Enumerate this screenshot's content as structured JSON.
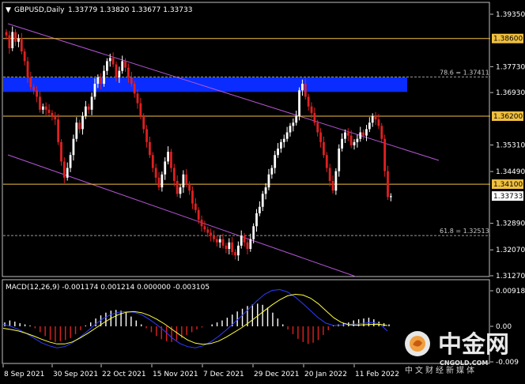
{
  "header": {
    "symbol": "GBPUSD,Daily",
    "ohlc": "1.33779 1.33820 1.33677 1.33733"
  },
  "macd": {
    "label": "MACD(12,26,9) -0.001174 0.001214 0.000000 -0.003105",
    "ticks": [
      {
        "v": 0.0091,
        "label": "0.009182"
      },
      {
        "v": 0.0,
        "label": "0.00"
      },
      {
        "v": -0.0091,
        "label": "-0.009"
      }
    ]
  },
  "watermark": {
    "brand": "中金网",
    "url": "CNGOLD.COM",
    "tagline": "中文财经新媒体"
  },
  "chart_data": {
    "type": "candlestick",
    "ylim": [
      1.3127,
      1.3955
    ],
    "y_ticks": [
      {
        "v": 1.3935,
        "label": "1.39350"
      },
      {
        "v": 1.3773,
        "label": "1.37730"
      },
      {
        "v": 1.3693,
        "label": "1.36930"
      },
      {
        "v": 1.3531,
        "label": "1.35310"
      },
      {
        "v": 1.3449,
        "label": "1.34490"
      },
      {
        "v": 1.3289,
        "label": "1.32890"
      },
      {
        "v": 1.3207,
        "label": "1.32070"
      },
      {
        "v": 1.3127,
        "label": "1.31270"
      }
    ],
    "x_ticks": [
      "8 Sep 2021",
      "30 Sep 2021",
      "22 Oct 2021",
      "15 Nov 2021",
      "7 Dec 2021",
      "29 Dec 2021",
      "20 Jan 2022",
      "11 Feb 2022"
    ],
    "levels": [
      {
        "v": 1.386,
        "label": "1.38600"
      },
      {
        "v": 1.362,
        "label": "1.36200"
      },
      {
        "v": 1.341,
        "label": "1.34100"
      }
    ],
    "current_price": {
      "v": 1.33733,
      "label": "1.33733"
    },
    "fibonacci": [
      {
        "v": 1.37411,
        "label": "78.6 = 1.37411"
      },
      {
        "v": 1.32513,
        "label": "61.8 = 1.32513"
      }
    ],
    "zone": {
      "from": 1.3695,
      "to": 1.374
    },
    "close": [
      1.387,
      1.383,
      1.388,
      1.385,
      1.386,
      1.382,
      1.379,
      1.374,
      1.371,
      1.37,
      1.368,
      1.364,
      1.365,
      1.364,
      1.363,
      1.362,
      1.361,
      1.354,
      1.348,
      1.343,
      1.346,
      1.35,
      1.355,
      1.36,
      1.358,
      1.362,
      1.365,
      1.364,
      1.368,
      1.372,
      1.374,
      1.372,
      1.376,
      1.379,
      1.38,
      1.378,
      1.374,
      1.376,
      1.379,
      1.377,
      1.374,
      1.372,
      1.369,
      1.366,
      1.362,
      1.358,
      1.354,
      1.35,
      1.346,
      1.343,
      1.34,
      1.344,
      1.348,
      1.351,
      1.346,
      1.342,
      1.338,
      1.34,
      1.344,
      1.341,
      1.339,
      1.335,
      1.333,
      1.33,
      1.328,
      1.327,
      1.326,
      1.325,
      1.324,
      1.323,
      1.324,
      1.322,
      1.321,
      1.323,
      1.32,
      1.319,
      1.322,
      1.325,
      1.323,
      1.321,
      1.324,
      1.328,
      1.332,
      1.334,
      1.338,
      1.34,
      1.344,
      1.346,
      1.35,
      1.352,
      1.354,
      1.355,
      1.357,
      1.359,
      1.36,
      1.362,
      1.37,
      1.372,
      1.368,
      1.365,
      1.363,
      1.36,
      1.357,
      1.354,
      1.35,
      1.346,
      1.342,
      1.339,
      1.345,
      1.352,
      1.355,
      1.357,
      1.356,
      1.353,
      1.354,
      1.355,
      1.357,
      1.356,
      1.358,
      1.36,
      1.362,
      1.361,
      1.359,
      1.355,
      1.345,
      1.337,
      1.3373
    ],
    "macd_hist": [
      0.001,
      0.0015,
      0.0012,
      0.0008,
      0.0005,
      0.0002,
      -0.0005,
      -0.0015,
      -0.0025,
      -0.0035,
      -0.004,
      -0.0038,
      -0.0035,
      -0.003,
      -0.002,
      -0.001,
      0.0002,
      0.001,
      0.002,
      0.0028,
      0.0035,
      0.004,
      0.0042,
      0.004,
      0.0035,
      0.0025,
      0.0015,
      0.0005,
      -0.0005,
      -0.0015,
      -0.0025,
      -0.0033,
      -0.0038,
      -0.004,
      -0.0036,
      -0.003,
      -0.0022,
      -0.0015,
      -0.0008,
      -0.0003,
      0.0,
      0.0005,
      0.001,
      0.0015,
      0.0022,
      0.003,
      0.0038,
      0.0045,
      0.0052,
      0.0056,
      0.0058,
      0.0055,
      0.0048,
      0.0035,
      0.002,
      0.0005,
      -0.0008,
      -0.002,
      -0.0032,
      -0.004,
      -0.0045,
      -0.0042,
      -0.0035,
      -0.0022,
      -0.001,
      0.0003,
      0.0005,
      0.0008,
      0.001,
      0.0015,
      0.0018,
      0.002,
      0.0022,
      0.0018,
      0.0012,
      0.0008,
      0.0005
    ],
    "macd_signal": [
      -0.0005,
      -0.0008,
      -0.0012,
      -0.0018,
      -0.0025,
      -0.0033,
      -0.004,
      -0.0045,
      -0.0045,
      -0.004,
      -0.003,
      -0.0018,
      -0.0005,
      0.0008,
      0.002,
      0.003,
      0.0036,
      0.0038,
      0.0035,
      0.0028,
      0.0018,
      0.0006,
      -0.0008,
      -0.0022,
      -0.0035,
      -0.0043,
      -0.0046,
      -0.0044,
      -0.0038,
      -0.0028,
      -0.0016,
      -0.0004,
      0.001,
      0.0025,
      0.004,
      0.0055,
      0.0068,
      0.0078,
      0.0082,
      0.008,
      0.0072,
      0.0058,
      0.004,
      0.0022,
      0.001,
      0.0004,
      0.0003,
      0.0004,
      0.0005,
      0.0005,
      0.0002
    ],
    "macd_main": [
      0.0005,
      0.0,
      -0.0008,
      -0.0018,
      -0.003,
      -0.0042,
      -0.005,
      -0.0055,
      -0.0052,
      -0.0042,
      -0.0028,
      -0.0012,
      0.0005,
      0.002,
      0.003,
      0.0036,
      0.0038,
      0.0036,
      0.003,
      0.0018,
      0.0004,
      -0.0012,
      -0.003,
      -0.0044,
      -0.0052,
      -0.0055,
      -0.005,
      -0.004,
      -0.0026,
      -0.001,
      0.0008,
      0.0026,
      0.0045,
      0.0065,
      0.0082,
      0.0092,
      0.0094,
      0.0088,
      0.0075,
      0.0058,
      0.004,
      0.0022,
      0.0008,
      0.0002,
      0.0003,
      0.0005,
      0.0006,
      0.0008,
      0.001,
      0.0006,
      -0.0012
    ]
  }
}
